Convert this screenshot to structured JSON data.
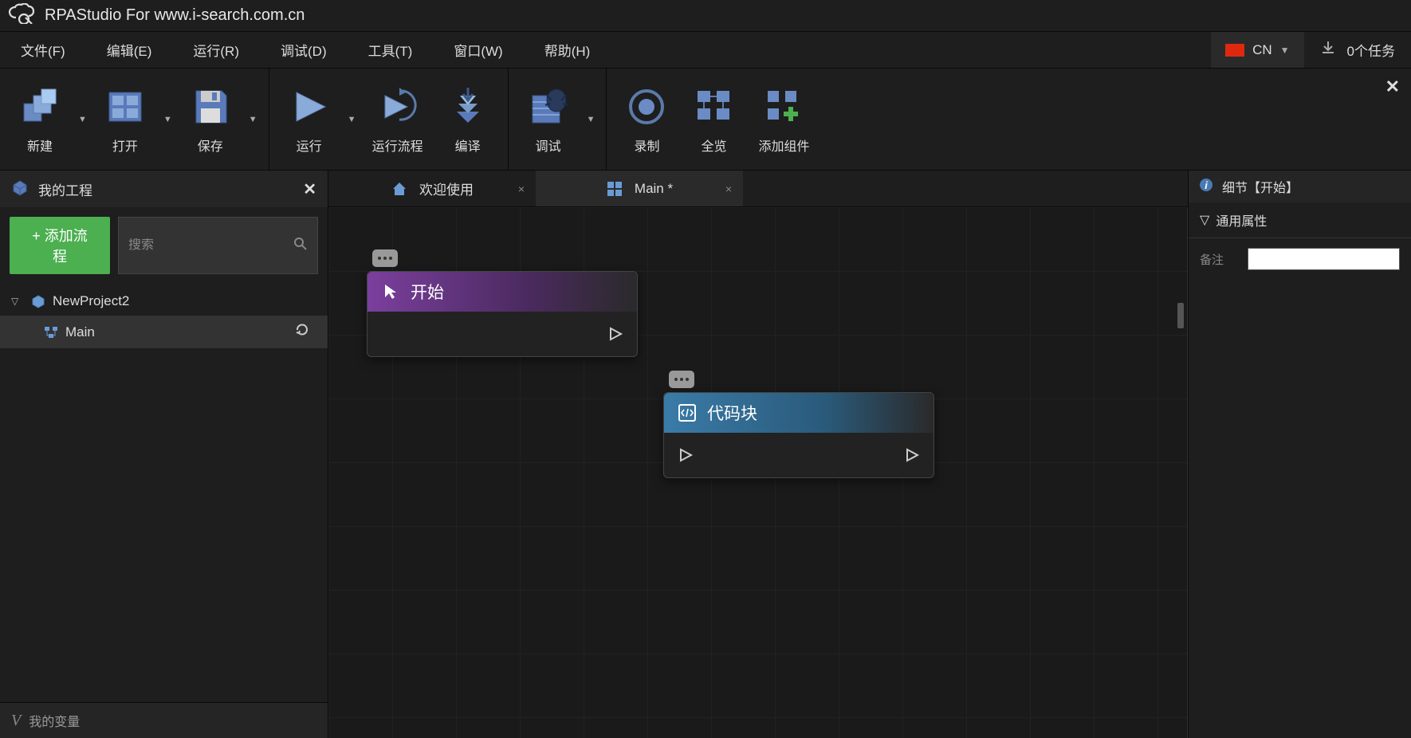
{
  "titlebar": {
    "text": "RPAStudio For www.i-search.com.cn"
  },
  "menubar": {
    "items": [
      "文件(F)",
      "编辑(E)",
      "运行(R)",
      "调试(D)",
      "工具(T)",
      "窗口(W)",
      "帮助(H)"
    ],
    "lang": "CN",
    "tasks": "0个任务"
  },
  "toolbar": {
    "groups": [
      {
        "items": [
          {
            "label": "新建",
            "dropdown": true,
            "icon": "new"
          },
          {
            "label": "打开",
            "dropdown": true,
            "icon": "open"
          },
          {
            "label": "保存",
            "dropdown": true,
            "icon": "save"
          }
        ]
      },
      {
        "items": [
          {
            "label": "运行",
            "dropdown": true,
            "icon": "run"
          },
          {
            "label": "运行流程",
            "dropdown": false,
            "icon": "runflow"
          },
          {
            "label": "编译",
            "dropdown": false,
            "icon": "compile"
          }
        ]
      },
      {
        "items": [
          {
            "label": "调试",
            "dropdown": true,
            "icon": "debug"
          }
        ]
      },
      {
        "items": [
          {
            "label": "录制",
            "dropdown": false,
            "icon": "record"
          },
          {
            "label": "全览",
            "dropdown": false,
            "icon": "overview"
          },
          {
            "label": "添加组件",
            "dropdown": false,
            "icon": "addcomp"
          }
        ]
      }
    ]
  },
  "sidebar": {
    "title": "我的工程",
    "add_flow_label": "+ 添加流程",
    "search_placeholder": "搜索",
    "project": "NewProject2",
    "file": "Main",
    "variables_label": "我的变量"
  },
  "tabs": [
    {
      "label": "欢迎使用",
      "icon": "home",
      "active": false
    },
    {
      "label": "Main  *",
      "icon": "grid",
      "active": true
    }
  ],
  "nodes": {
    "start": {
      "title": "开始"
    },
    "code": {
      "title": "代码块"
    }
  },
  "right_panel": {
    "title": "细节【开始】",
    "section": "通用属性",
    "field_label": "备注"
  }
}
